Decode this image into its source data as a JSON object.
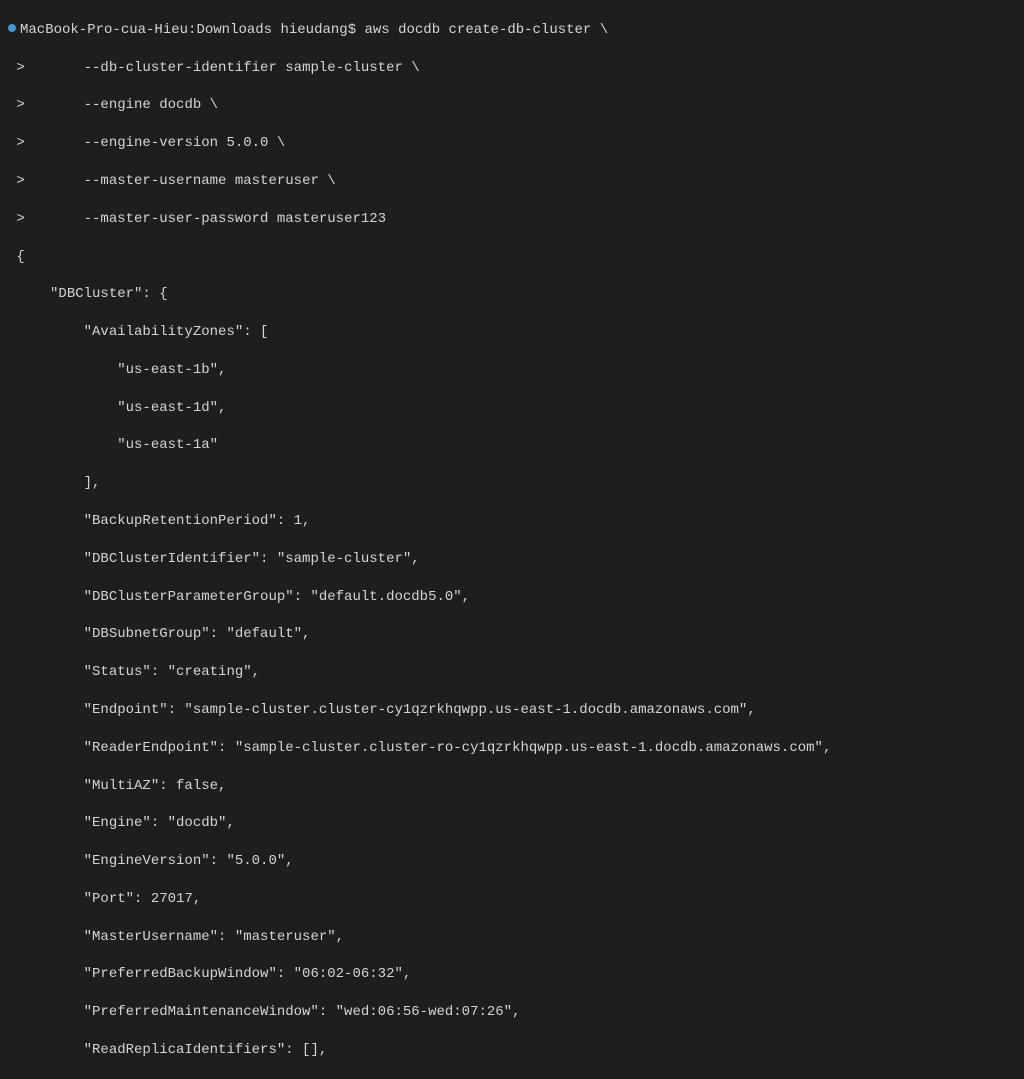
{
  "prompt": {
    "host": "MacBook-Pro-cua-Hieu",
    "dir": "Downloads",
    "user": "hieudang",
    "cmd0": "aws docdb create-db-cluster \\",
    "cont1": "      --db-cluster-identifier sample-cluster \\",
    "cont2": "      --engine docdb \\",
    "cont3": "      --engine-version 5.0.0 \\",
    "cont4": "      --master-username masteruser \\",
    "cont5": "      --master-user-password masteruser123"
  },
  "output": {
    "l00": "{",
    "l01": "    \"DBCluster\": {",
    "l02": "        \"AvailabilityZones\": [",
    "l03": "            \"us-east-1b\",",
    "l04": "            \"us-east-1d\",",
    "l05": "            \"us-east-1a\"",
    "l06": "        ],",
    "l07": "        \"BackupRetentionPeriod\": 1,",
    "l08": "        \"DBClusterIdentifier\": \"sample-cluster\",",
    "l09": "        \"DBClusterParameterGroup\": \"default.docdb5.0\",",
    "l10": "        \"DBSubnetGroup\": \"default\",",
    "l11": "        \"Status\": \"creating\",",
    "l12": "        \"Endpoint\": \"sample-cluster.cluster-cy1qzrkhqwpp.us-east-1.docdb.amazonaws.com\",",
    "l13": "        \"ReaderEndpoint\": \"sample-cluster.cluster-ro-cy1qzrkhqwpp.us-east-1.docdb.amazonaws.com\",",
    "l14": "        \"MultiAZ\": false,",
    "l15": "        \"Engine\": \"docdb\",",
    "l16": "        \"EngineVersion\": \"5.0.0\",",
    "l17": "        \"Port\": 27017,",
    "l18": "        \"MasterUsername\": \"masteruser\",",
    "l19": "        \"PreferredBackupWindow\": \"06:02-06:32\",",
    "l20": "        \"PreferredMaintenanceWindow\": \"wed:06:56-wed:07:26\",",
    "l21": "        \"ReadReplicaIdentifiers\": [],"
  }
}
